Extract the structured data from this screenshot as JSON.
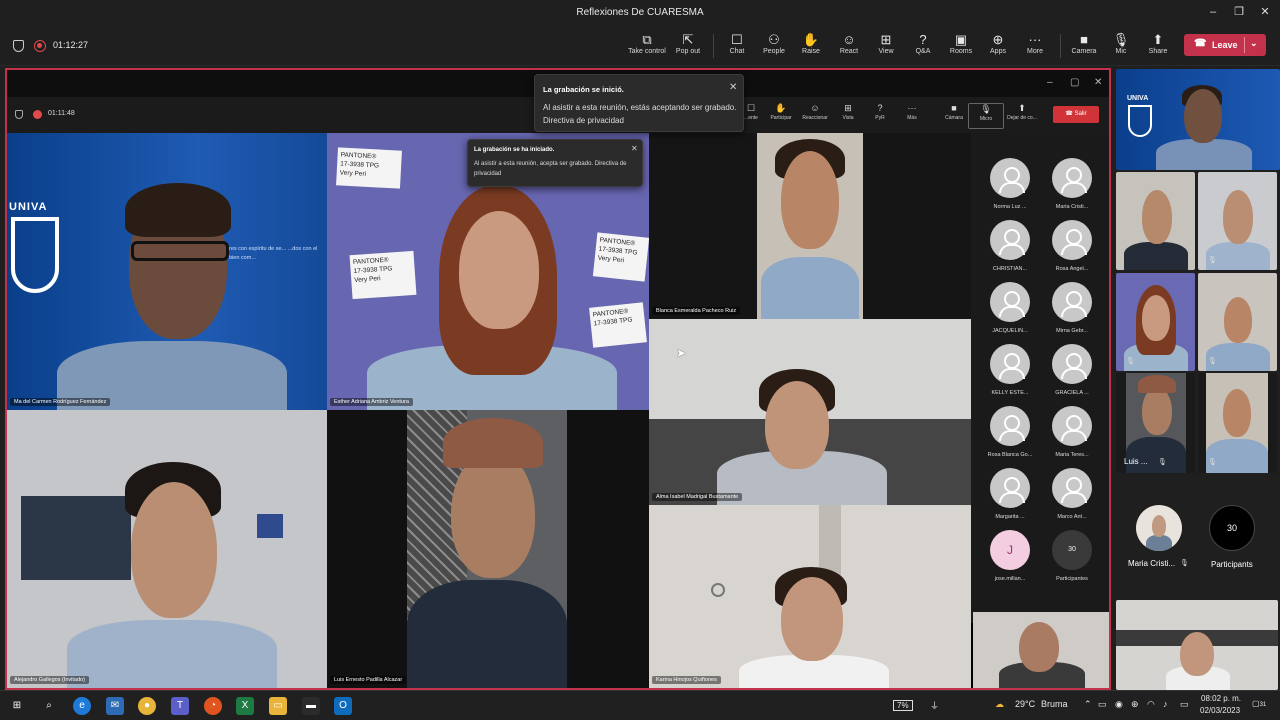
{
  "window": {
    "title": "Reflexiones De CUARESMA"
  },
  "toolbar": {
    "timer": "01:12:27",
    "buttons": [
      {
        "label": "Take control",
        "icon": "⧉"
      },
      {
        "label": "Pop out",
        "icon": "⇱"
      },
      {
        "label": "Chat",
        "icon": "☐"
      },
      {
        "label": "People",
        "icon": "⚇"
      },
      {
        "label": "Raise",
        "icon": "✋"
      },
      {
        "label": "React",
        "icon": "☺"
      },
      {
        "label": "View",
        "icon": "⊞"
      },
      {
        "label": "Q&A",
        "icon": "?"
      },
      {
        "label": "Rooms",
        "icon": "▣"
      },
      {
        "label": "Apps",
        "icon": "⊕"
      },
      {
        "label": "More",
        "icon": "···"
      },
      {
        "label": "Camera",
        "icon": "■"
      },
      {
        "label": "Mic",
        "icon": "🎙"
      },
      {
        "label": "Share",
        "icon": "⬆"
      }
    ],
    "leave_label": "Leave"
  },
  "shared": {
    "inner_timer": "01:11:48",
    "inner_buttons": [
      "...ente",
      "Participar",
      "Reaccionar",
      "Vista",
      "PyR",
      "Más",
      "Cámara",
      "Micro",
      "Dejar de co..."
    ],
    "inner_leave": "Salir",
    "toast_main": {
      "title": "La grabación se inició.",
      "body": "Al asistir a esta reunión, estás aceptando ser grabado. Directiva de privacidad"
    },
    "toast_small": {
      "title": "La grabación se ha iniciado.",
      "body": "Al asistir a esta reunión, acepta ser grabado. Directiva de privacidad"
    },
    "tiles": [
      {
        "name": "Ma del Carmen Rodríguez Fernández"
      },
      {
        "name": "Esther Adriana Ambriz Ventura"
      },
      {
        "name": "Blanca Esmeralda Pacheco Ruiz"
      },
      {
        "name": "Alma Isabel Madrigal Bustamante"
      },
      {
        "name": "Alejandro Gallegos (Invitado)"
      },
      {
        "name": "Luis Ernesto Padilla Alcazar"
      },
      {
        "name": "Karina Hinojos Quiñones"
      }
    ],
    "pantone_lines": [
      "PANTONE®",
      "17-3938 TPG",
      "Very Peri"
    ],
    "logo_text": "UNIVA",
    "banner_text": "res con espíritu de se... ...dos con el bien com...",
    "participants": [
      "Norma Luz ...",
      "Maria Cristi...",
      "CHRISTIAN...",
      "Rosa Angel...",
      "JACQUELIN...",
      "Mirna Gebr...",
      "KELLY ESTE...",
      "GRACIELA ...",
      "Rosa Blanca Go...",
      "Maria Teres...",
      "Margarita ...",
      "Marco Ant..."
    ],
    "last_participant": {
      "initial": "J",
      "name": "jose.millan..."
    },
    "participants_count": "30",
    "participants_label": "Participantes"
  },
  "right_panel": {
    "logo_text": "UNIVA",
    "luis_label": "Luis ...",
    "maria_label": "Maria Cristi...",
    "count": "30",
    "count_label": "Participants"
  },
  "taskbar": {
    "battery": "7%",
    "weather_temp": "29°C",
    "weather_desc": "Bruma",
    "time": "08:02 p. m.",
    "date": "02/03/2023",
    "notif": "31"
  },
  "colors": {
    "leave_red": "#c4314b",
    "share_border": "#c4314b",
    "teams_purple": "#5b5fc7"
  }
}
